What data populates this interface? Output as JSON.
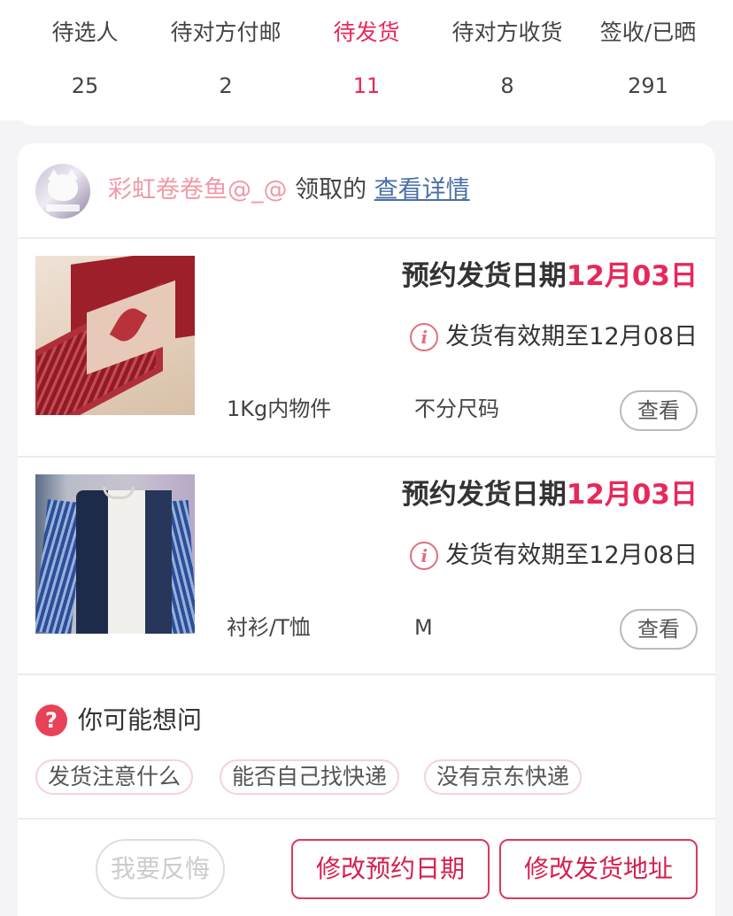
{
  "tabs": [
    {
      "label": "待选人",
      "count": "25",
      "active": false
    },
    {
      "label": "待对方付邮",
      "count": "2",
      "active": false
    },
    {
      "label": "待发货",
      "count": "11",
      "active": true
    },
    {
      "label": "待对方收货",
      "count": "8",
      "active": false
    },
    {
      "label": "签收/已晒",
      "count": "291",
      "active": false
    }
  ],
  "claim": {
    "nickname": "彩虹卷卷鱼@_@",
    "claimed_text": "领取的",
    "detail_link": "查看详情"
  },
  "items": [
    {
      "ship_label": "预约发货日期",
      "ship_date": "12月03日",
      "validity": "发货有效期至12月08日",
      "category": "1Kg内物件",
      "size": "不分尺码",
      "view_label": "查看"
    },
    {
      "ship_label": "预约发货日期",
      "ship_date": "12月03日",
      "validity": "发货有效期至12月08日",
      "category": "衬衫/T恤",
      "size": "M",
      "view_label": "查看"
    }
  ],
  "faq": {
    "icon_glyph": "?",
    "title": "你可能想问",
    "chips": [
      "发货注意什么",
      "能否自己找快递",
      "没有京东快递"
    ]
  },
  "footer": {
    "regret_label": "我要反悔",
    "change_date_label": "修改预约日期",
    "change_address_label": "修改发货地址"
  },
  "colors": {
    "accent": "#e8285a",
    "link": "#4a6fa5",
    "nickname": "#f09aa8"
  }
}
